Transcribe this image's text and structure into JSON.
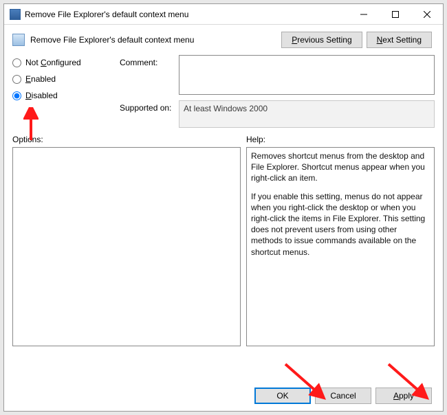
{
  "window": {
    "title": "Remove File Explorer's default context menu"
  },
  "header": {
    "policy_title": "Remove File Explorer's default context menu",
    "prev_button_html": "<u>P</u>revious Setting",
    "next_button_html": "<u>N</u>ext Setting"
  },
  "radios": {
    "not_configured_html": "Not <u>C</u>onfigured",
    "enabled_html": "<u>E</u>nabled",
    "disabled_html": "<u>D</u>isabled",
    "selected": "disabled"
  },
  "labels": {
    "comment": "Comment:",
    "supported_on": "Supported on:",
    "options": "Options:",
    "help": "Help:"
  },
  "fields": {
    "comment_value": "",
    "supported_on_value": "At least Windows 2000"
  },
  "help": {
    "p1": "Removes shortcut menus from the desktop and File Explorer. Shortcut menus appear when you right-click an item.",
    "p2": "If you enable this setting, menus do not appear when you right-click the desktop or when you right-click the items in File Explorer. This setting does not prevent users from using other methods to issue commands available on the shortcut menus."
  },
  "buttons": {
    "ok": "OK",
    "cancel": "Cancel",
    "apply_html": "<u>A</u>pply"
  }
}
